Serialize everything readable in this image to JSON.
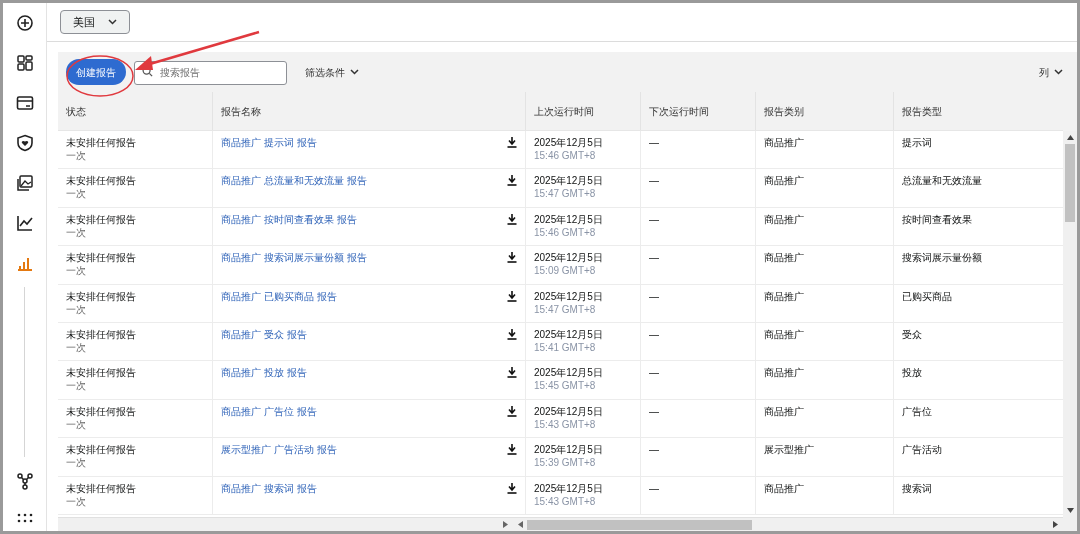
{
  "sidebar": {
    "items": [
      {
        "kind": "add",
        "selected": false
      },
      {
        "kind": "dashboard",
        "selected": false
      },
      {
        "kind": "card",
        "selected": false
      },
      {
        "kind": "shield",
        "selected": false
      },
      {
        "kind": "images",
        "selected": false
      },
      {
        "kind": "trend",
        "selected": false
      },
      {
        "kind": "bars",
        "selected": true
      }
    ],
    "bottom_items": [
      {
        "kind": "network",
        "selected": false
      },
      {
        "kind": "apps",
        "selected": false
      }
    ]
  },
  "marketplace": {
    "value": "美国"
  },
  "toolbar": {
    "create_button": "创建报告",
    "search": {
      "placeholder": "搜索报告"
    },
    "filter": "筛选条件",
    "columns": "列"
  },
  "table": {
    "columns": [
      "状态",
      "报告名称",
      "上次运行时间",
      "下次运行时间",
      "报告类别",
      "报告类型"
    ],
    "rows": [
      {
        "status": "未安排任何报告",
        "frequency": "一次",
        "name": "商品推广 提示词 报告",
        "last_date": "2025年12月5日",
        "last_time": "15:46 GMT+8",
        "next": "—",
        "category": "商品推广",
        "type": "提示词"
      },
      {
        "status": "未安排任何报告",
        "frequency": "一次",
        "name": "商品推广 总流量和无效流量 报告",
        "last_date": "2025年12月5日",
        "last_time": "15:47 GMT+8",
        "next": "—",
        "category": "商品推广",
        "type": "总流量和无效流量"
      },
      {
        "status": "未安排任何报告",
        "frequency": "一次",
        "name": "商品推广 按时间查看效果 报告",
        "last_date": "2025年12月5日",
        "last_time": "15:46 GMT+8",
        "next": "—",
        "category": "商品推广",
        "type": "按时间查看效果"
      },
      {
        "status": "未安排任何报告",
        "frequency": "一次",
        "name": "商品推广 搜索词展示量份额 报告",
        "last_date": "2025年12月5日",
        "last_time": "15:09 GMT+8",
        "next": "—",
        "category": "商品推广",
        "type": "搜索词展示量份额"
      },
      {
        "status": "未安排任何报告",
        "frequency": "一次",
        "name": "商品推广 已购买商品 报告",
        "last_date": "2025年12月5日",
        "last_time": "15:47 GMT+8",
        "next": "—",
        "category": "商品推广",
        "type": "已购买商品"
      },
      {
        "status": "未安排任何报告",
        "frequency": "一次",
        "name": "商品推广 受众 报告",
        "last_date": "2025年12月5日",
        "last_time": "15:41 GMT+8",
        "next": "—",
        "category": "商品推广",
        "type": "受众"
      },
      {
        "status": "未安排任何报告",
        "frequency": "一次",
        "name": "商品推广 投放 报告",
        "last_date": "2025年12月5日",
        "last_time": "15:45 GMT+8",
        "next": "—",
        "category": "商品推广",
        "type": "投放"
      },
      {
        "status": "未安排任何报告",
        "frequency": "一次",
        "name": "商品推广 广告位 报告",
        "last_date": "2025年12月5日",
        "last_time": "15:43 GMT+8",
        "next": "—",
        "category": "商品推广",
        "type": "广告位"
      },
      {
        "status": "未安排任何报告",
        "frequency": "一次",
        "name": "展示型推广 广告活动 报告",
        "last_date": "2025年12月5日",
        "last_time": "15:39 GMT+8",
        "next": "—",
        "category": "展示型推广",
        "type": "广告活动"
      },
      {
        "status": "未安排任何报告",
        "frequency": "一次",
        "name": "商品推广 搜索词 报告",
        "last_date": "2025年12月5日",
        "last_time": "15:43 GMT+8",
        "next": "—",
        "category": "商品推广",
        "type": "搜索词"
      }
    ]
  }
}
